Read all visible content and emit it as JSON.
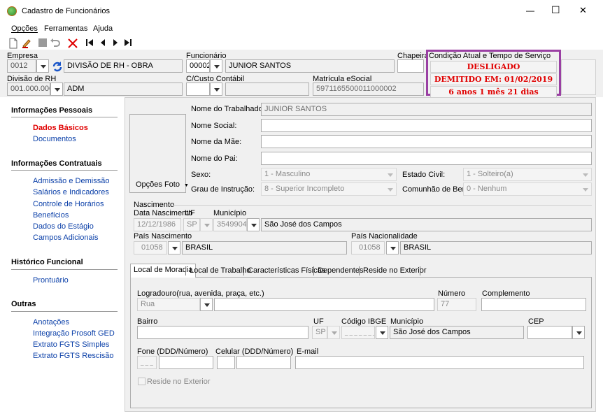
{
  "window": {
    "title": "Cadastro de Funcionários",
    "min": "—",
    "max": "☐",
    "close": "✕"
  },
  "menu": {
    "opcoes": "Opções",
    "ferramentas": "Ferramentas",
    "ajuda": "Ajuda"
  },
  "header": {
    "empresa_label": "Empresa",
    "empresa_code": "0012",
    "empresa_name": "DIVISÃO DE RH - OBRA",
    "funcionario_label": "Funcionário",
    "funcionario_code": "00002",
    "funcionario_name": "JUNIOR SANTOS",
    "chapeira_label": "Chapeira",
    "chapeira_value": "",
    "divisao_label": "Divisão de RH",
    "divisao_code": "001.000.000",
    "divisao_name": "ADM",
    "ccusto_label": "C/Custo Contábil",
    "matricula_label": "Matrícula eSocial",
    "matricula_value": "5971165500011000002"
  },
  "status": {
    "label": "Condição Atual e Tempo de Serviço",
    "condition": "DESLIGADO",
    "dismissal": "DEMITIDO EM: 01/02/2019",
    "tenure": "6 anos 1 mês 21 dias",
    "highlight_color": "#9a3fa3",
    "alert_color": "#e00000"
  },
  "sidebar": {
    "sections": [
      {
        "title": "Informações Pessoais",
        "items": [
          "Dados Básicos",
          "Documentos"
        ]
      },
      {
        "title": "Informações Contratuais",
        "items": [
          "Admissão e Demissão",
          "Salários e Indicadores",
          "Controle de Horários",
          "Benefícios",
          "Dados do Estágio",
          "Campos Adicionais"
        ]
      },
      {
        "title": "Histórico Funcional",
        "items": [
          "Prontuário"
        ]
      },
      {
        "title": "Outras",
        "items": [
          "Anotações",
          "Integração Prosoft GED",
          "Extrato FGTS Simples",
          "Extrato FGTS Rescisão"
        ]
      }
    ],
    "active_item": "Dados Básicos"
  },
  "basic": {
    "photo_button": "Opções Foto",
    "nome_label": "Nome do Trabalhador:",
    "nome_value": "JUNIOR SANTOS",
    "social_label": "Nome Social:",
    "mae_label": "Nome da Mãe:",
    "pai_label": "Nome do Pai:",
    "sexo_label": "Sexo:",
    "sexo_value": "1 - Masculino",
    "civil_label": "Estado Civil:",
    "civil_value": "1 - Solteiro(a)",
    "instrucao_label": "Grau de Instrução:",
    "instrucao_value": "8 - Superior Incompleto",
    "bens_label": "Comunhão de Bens:",
    "bens_value": "0 - Nenhum"
  },
  "nascimento": {
    "group_label": "Nascimento",
    "data_label": "Data Nascimento",
    "data_value": "12/12/1986",
    "uf_label": "UF",
    "uf_value": "SP",
    "municipio_label": "Município",
    "municipio_code": "3549904",
    "municipio_name": "São José dos Campos",
    "pais_nasc_label": "País Nascimento",
    "pais_nasc_code": "01058",
    "pais_nasc_name": "BRASIL",
    "pais_nac_label": "País Nacionalidade",
    "pais_nac_code": "01058",
    "pais_nac_name": "BRASIL"
  },
  "tabs": [
    "Local de Moradia",
    "Local de Trabalho",
    "Características Físicas",
    "Dependentes",
    "Reside no Exterior"
  ],
  "moradia": {
    "logradouro_label": "Logradouro(rua, avenida, praça, etc.)",
    "logradouro_type": "Rua",
    "numero_label": "Número",
    "numero_value": "77",
    "complemento_label": "Complemento",
    "bairro_label": "Bairro",
    "uf_label": "UF",
    "uf_value": "SP",
    "ibge_label": "Código IBGE",
    "ibge_value": "_ _ _ _ _ _ _",
    "municipio_label": "Município",
    "municipio_value": "São José dos Campos",
    "cep_label": "CEP",
    "fone_label": "Fone (DDD/Número)",
    "fone_ddd": "_ _ _",
    "celular_label": "Celular (DDD/Número)",
    "email_label": "E-mail",
    "reside_label": "Reside no Exterior"
  }
}
